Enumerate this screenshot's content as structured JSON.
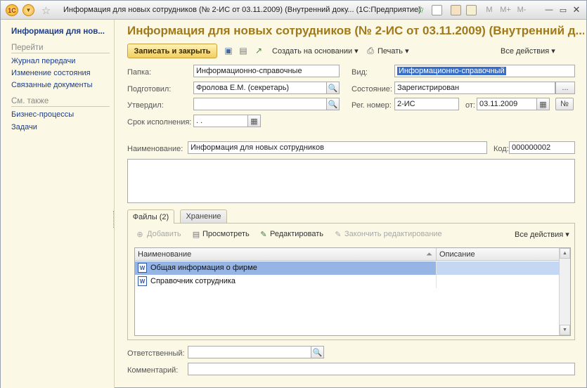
{
  "window": {
    "title": "Информация для новых сотрудников (№ 2-ИС от 03.11.2009) (Внутренний доку... (1С:Предприятие)",
    "logo_text": "1С",
    "right_icons": [
      "M",
      "M+",
      "M-"
    ]
  },
  "nav": {
    "title": "Информация для нов...",
    "section_go": "Перейти",
    "links_go": [
      "Журнал передачи",
      "Изменение состояния",
      "Связанные документы"
    ],
    "section_see_also": "См. также",
    "links_see_also": [
      "Бизнес-процессы",
      "Задачи"
    ]
  },
  "form": {
    "title": "Информация для новых сотрудников (№ 2-ИС от 03.11.2009) (Внутренний д...",
    "toolbar": {
      "save_close": "Записать и закрыть",
      "create_based": "Создать на основании",
      "print": "Печать",
      "all_actions": "Все действия"
    },
    "labels": {
      "folder": "Папка:",
      "prepared": "Подготовил:",
      "approved": "Утвердил:",
      "deadline": "Срок исполнения:",
      "type": "Вид:",
      "state": "Состояние:",
      "reg_number": "Рег. номер:",
      "from": "от:",
      "name": "Наименование:",
      "code": "Код:",
      "responsible": "Ответственный:",
      "comment": "Комментарий:"
    },
    "values": {
      "folder": "Информационно-справочные",
      "prepared": "Фролова Е.М. (секретарь)",
      "approved": "",
      "deadline": " .  .",
      "type": "Информационно-справочный",
      "state": "Зарегистрирован",
      "reg_number": "2-ИС",
      "date": "03.11.2009",
      "number_button": "№",
      "name": "Информация для новых сотрудников",
      "code": "000000002",
      "responsible": "",
      "comment": ""
    },
    "tabs": [
      "Файлы (2)",
      "Хранение"
    ],
    "files_toolbar": {
      "add": "Добавить",
      "view": "Просмотреть",
      "edit": "Редактировать",
      "finish_edit": "Закончить редактирование",
      "all_actions": "Все действия"
    },
    "files_table": {
      "columns": [
        "Наименование",
        "Описание"
      ],
      "rows": [
        {
          "name": "Общая информация о фирме",
          "description": "",
          "selected": true
        },
        {
          "name": "Справочник сотрудника",
          "description": "",
          "selected": false
        }
      ]
    }
  },
  "colors": {
    "background": "#fbf8e6",
    "title": "#a07a1a",
    "link": "#1c3d8a",
    "selection": "#96b4e4"
  }
}
